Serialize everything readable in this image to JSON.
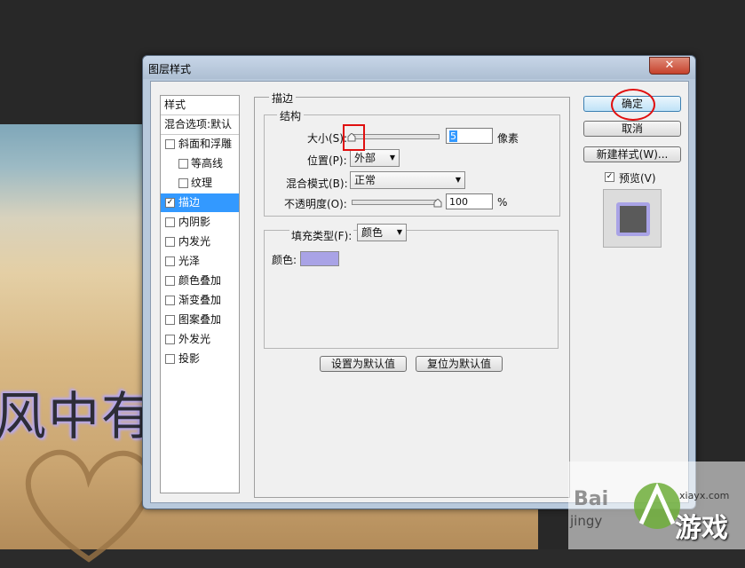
{
  "canvas": {
    "text": "风中有"
  },
  "dialog": {
    "title": "图层样式",
    "close_symbol": "✕",
    "styles_header": "样式",
    "blend_options": "混合选项:默认",
    "styles": [
      {
        "label": "斜面和浮雕",
        "checked": false,
        "indent": false
      },
      {
        "label": "等高线",
        "checked": false,
        "indent": true
      },
      {
        "label": "纹理",
        "checked": false,
        "indent": true
      },
      {
        "label": "描边",
        "checked": true,
        "indent": false,
        "selected": true
      },
      {
        "label": "内阴影",
        "checked": false,
        "indent": false
      },
      {
        "label": "内发光",
        "checked": false,
        "indent": false
      },
      {
        "label": "光泽",
        "checked": false,
        "indent": false
      },
      {
        "label": "颜色叠加",
        "checked": false,
        "indent": false
      },
      {
        "label": "渐变叠加",
        "checked": false,
        "indent": false
      },
      {
        "label": "图案叠加",
        "checked": false,
        "indent": false
      },
      {
        "label": "外发光",
        "checked": false,
        "indent": false
      },
      {
        "label": "投影",
        "checked": false,
        "indent": false
      }
    ],
    "stroke_title": "描边",
    "structure_title": "结构",
    "size_label": "大小(S):",
    "size_value": "5",
    "size_unit": "像素",
    "position_label": "位置(P):",
    "position_value": "外部",
    "blend_mode_label": "混合模式(B):",
    "blend_mode_value": "正常",
    "opacity_label": "不透明度(O):",
    "opacity_value": "100",
    "opacity_unit": "%",
    "fill_type_label": "填充类型(F):",
    "fill_type_value": "颜色",
    "color_label": "颜色:",
    "stroke_color": "#a9a3e6",
    "make_default": "设置为默认值",
    "reset_default": "复位为默认值",
    "ok": "确定",
    "cancel": "取消",
    "new_style": "新建样式(W)...",
    "preview_label": "预览(V)",
    "preview_checked": true,
    "checkmark": "✓",
    "size_slider_fraction": 0.0,
    "opacity_slider_fraction": 1.0
  },
  "watermark": {
    "line1": "Bai",
    "line2": "jingy",
    "brand": "游戏",
    "site": "xiayx.com"
  }
}
